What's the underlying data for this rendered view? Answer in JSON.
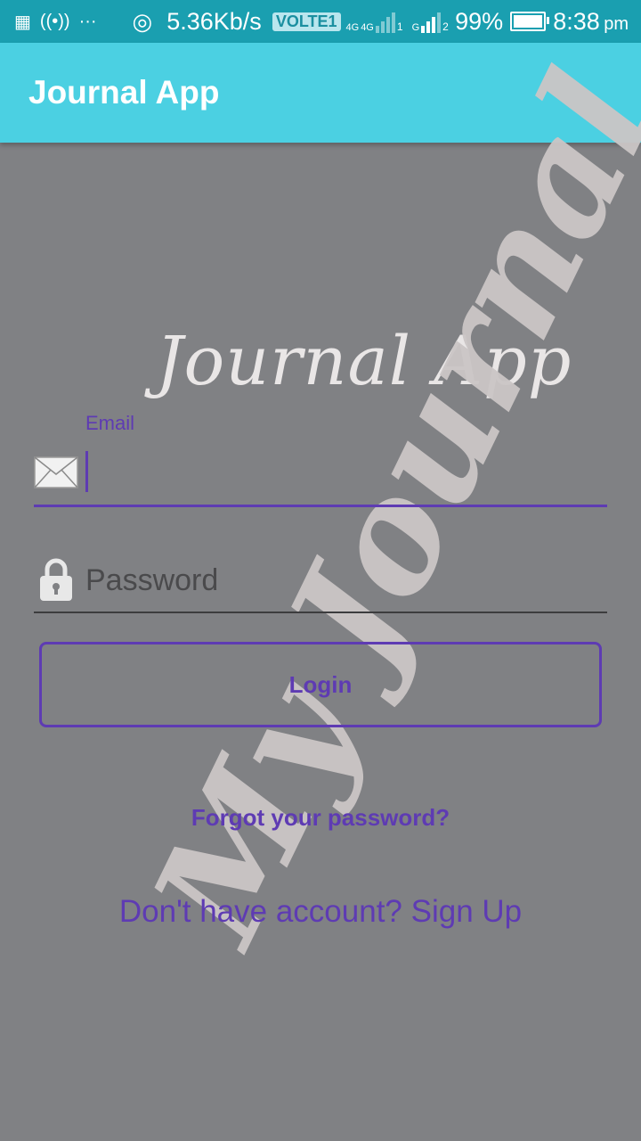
{
  "status_bar": {
    "more_glyph": "···",
    "speed": "5.36Kb/s",
    "volte": "VOLTE1",
    "net_label_1": "4G",
    "net_label_2": "4G",
    "sim1": "1",
    "net_label_3": "G",
    "sim2": "2",
    "battery_pct": "99%",
    "battery_level": 0.99,
    "time": "8:38",
    "ampm": "pm",
    "icons": [
      "notification-grid-icon",
      "hotspot-icon",
      "wifi-data-icon",
      "signal-icon",
      "battery-icon"
    ]
  },
  "app_bar": {
    "title": "Journal App"
  },
  "background": {
    "logo_text": "Journal App",
    "watermark_text": "My Journal"
  },
  "form": {
    "email_label": "Email",
    "email_value": "",
    "password_placeholder": "Password",
    "login_label": "Login",
    "forgot_label": "Forgot your password?",
    "signup_label": "Don't have account? Sign Up"
  },
  "colors": {
    "status_bar": "#1a9fb0",
    "app_bar": "#4bd0e2",
    "background": "#808184",
    "accent": "#5e3bb3"
  }
}
